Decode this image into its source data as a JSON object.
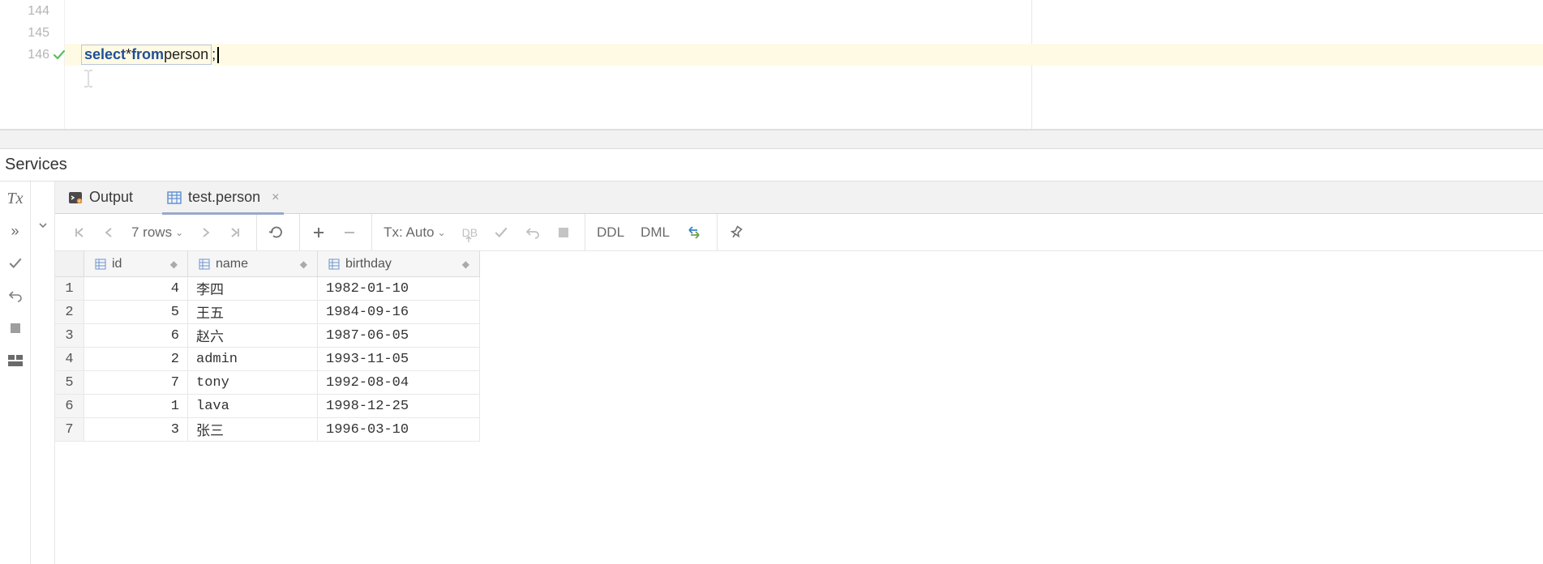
{
  "editor": {
    "lines": [
      {
        "num": "144"
      },
      {
        "num": "145"
      },
      {
        "num": "146",
        "check": true,
        "sql_kw1": "select",
        "sql_star": " * ",
        "sql_kw2": "from",
        "sql_sp": " ",
        "sql_tbl": "person",
        "sql_semi": ";"
      }
    ]
  },
  "services_title": "Services",
  "left_toolbar": {
    "tx": "Tx",
    "expand": "»"
  },
  "tabs": {
    "output": "Output",
    "result": "test.person"
  },
  "toolbar": {
    "row_count": "7 rows",
    "tx_mode": "Tx: Auto",
    "db_label": "DB",
    "ddl": "DDL",
    "dml": "DML"
  },
  "table": {
    "columns": [
      "id",
      "name",
      "birthday"
    ],
    "rows": [
      {
        "n": "1",
        "id": "4",
        "name": "李四",
        "birthday": "1982-01-10"
      },
      {
        "n": "2",
        "id": "5",
        "name": "王五",
        "birthday": "1984-09-16"
      },
      {
        "n": "3",
        "id": "6",
        "name": "赵六",
        "birthday": "1987-06-05"
      },
      {
        "n": "4",
        "id": "2",
        "name": "admin",
        "birthday": "1993-11-05"
      },
      {
        "n": "5",
        "id": "7",
        "name": "tony",
        "birthday": "1992-08-04"
      },
      {
        "n": "6",
        "id": "1",
        "name": "lava",
        "birthday": "1998-12-25"
      },
      {
        "n": "7",
        "id": "3",
        "name": "张三",
        "birthday": "1996-03-10"
      }
    ]
  }
}
